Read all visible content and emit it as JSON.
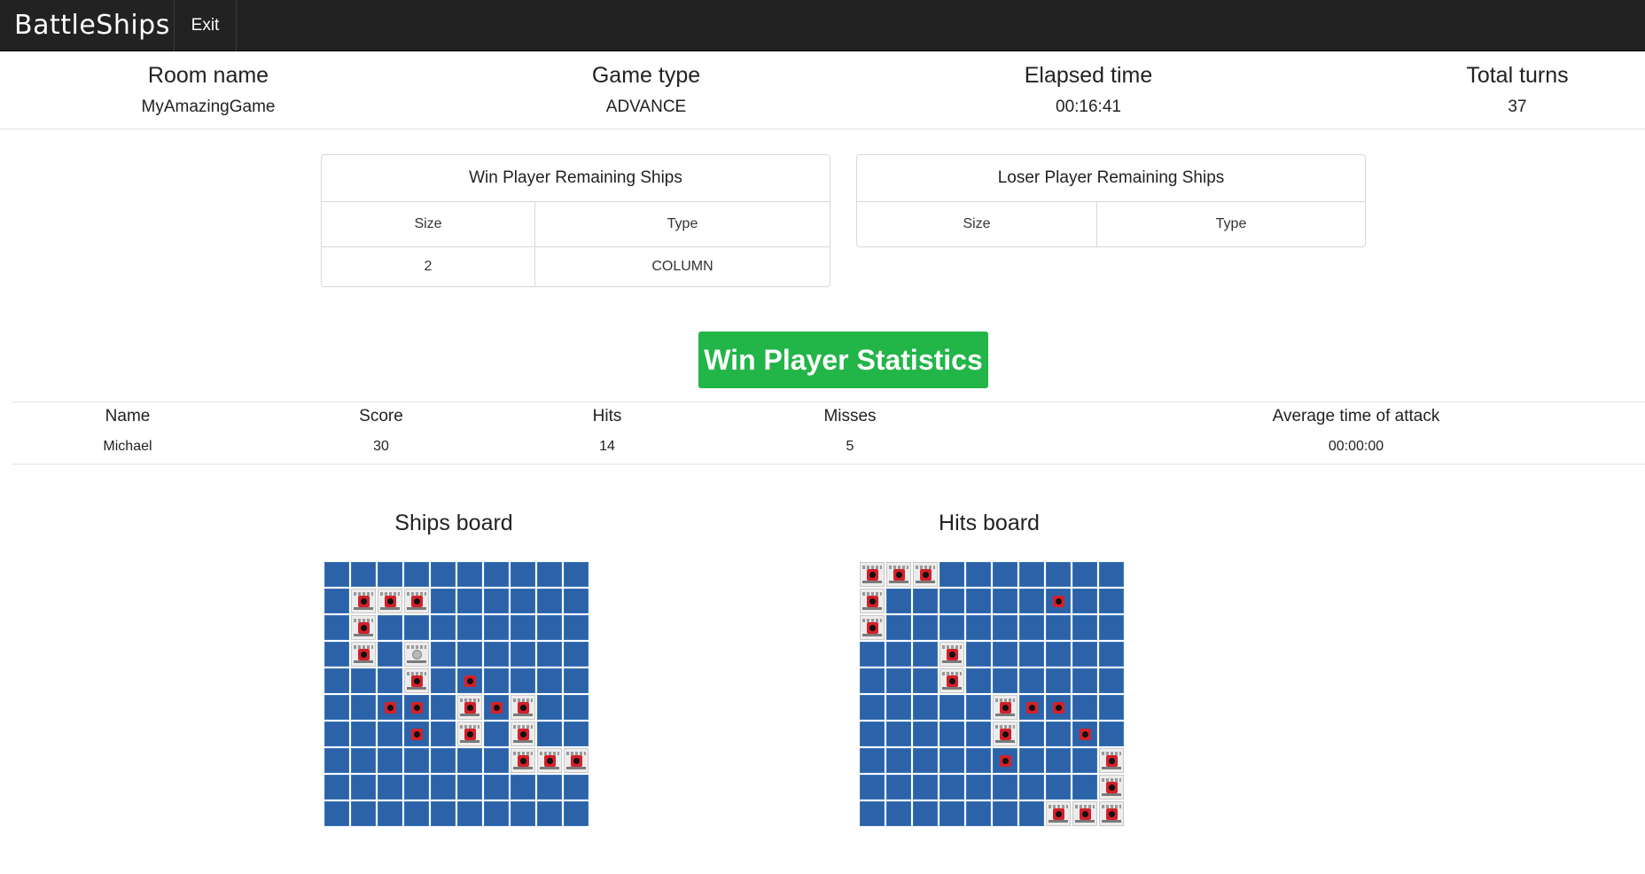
{
  "nav": {
    "brand": "BattleShips",
    "exit_label": "Exit"
  },
  "game_info": [
    {
      "label": "Room name",
      "value": "MyAmazingGame"
    },
    {
      "label": "Game type",
      "value": "ADVANCE"
    },
    {
      "label": "Elapsed time",
      "value": "00:16:41"
    },
    {
      "label": "Total turns",
      "value": "37"
    }
  ],
  "win_ships": {
    "title": "Win Player Remaining Ships",
    "headers": [
      "Size",
      "Type"
    ],
    "rows": [
      [
        "2",
        "COLUMN"
      ]
    ]
  },
  "loser_ships": {
    "title": "Loser Player Remaining Ships",
    "headers": [
      "Size",
      "Type"
    ],
    "rows": []
  },
  "stats": {
    "button_label": "Win Player Statistics",
    "headers": [
      "Name",
      "Score",
      "Hits",
      "Misses",
      "Average time of attack"
    ],
    "values": [
      "Michael",
      "30",
      "14",
      "5",
      "00:00:00"
    ]
  },
  "boards": {
    "ships_title": "Ships board",
    "hits_title": "Hits board",
    "legend": {
      "W": "water",
      "M": "miss",
      "S": "ship-hit",
      "U": "ship-untouched"
    },
    "ships_grid": [
      "WWWWWWWWWW",
      "WSSSWWWWWW",
      "WSWWWWWWWW",
      "WSWUWWWWWW",
      "WWWSWMWWWW",
      "WWMMWSMSWW",
      "WWWMWSWSWW",
      "WWWWWWWSSS",
      "WWWWWWWWWW",
      "WWWWWWWWWW"
    ],
    "hits_grid": [
      "SSSWWWWWWW",
      "SWWWWWWMWW",
      "SWWWWWWWWW",
      "WWWSWWWWWW",
      "WWWSWWWWWW",
      "WWWWWSMMWW",
      "WWWWWSWWMW",
      "WWWWWMWWWS",
      "WWWWWWWWWS",
      "WWWWWWWSSS"
    ]
  }
}
